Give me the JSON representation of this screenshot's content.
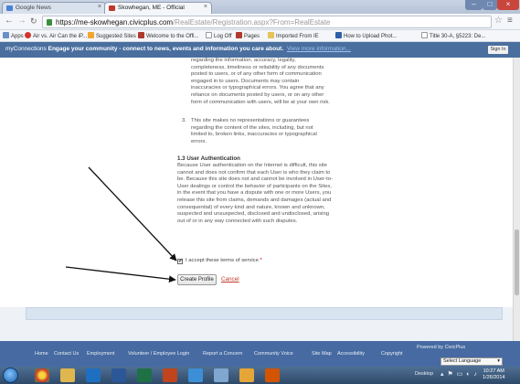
{
  "browser": {
    "tabs": [
      {
        "label": "Google News"
      },
      {
        "label": "Skowhegan, ME - Official"
      }
    ],
    "url": {
      "host": "https://me-skowhegan.civicplus.com",
      "path": "/RealEstate/Registration.aspx?From=RealEstate"
    },
    "bookmarks": [
      {
        "label": "Apps",
        "icon": "apps-grid-icon"
      },
      {
        "label": "Air vs. Air Can the iP...",
        "icon": "red-circle-icon"
      },
      {
        "label": "Suggested Sites",
        "icon": "suggested-sites-icon"
      },
      {
        "label": "Welcome to the Offi...",
        "icon": "civicplus-icon"
      },
      {
        "label": "Log Off",
        "icon": "page-icon"
      },
      {
        "label": "Pages",
        "icon": "civicplus-icon"
      },
      {
        "label": "Imported From IE",
        "icon": "folder-icon"
      },
      {
        "label": "How to Upload Phot...",
        "icon": "blue-square-icon"
      },
      {
        "label": "Title 30-A, §5223: De...",
        "icon": "page-icon"
      }
    ],
    "colors": {
      "banner": "#4a6f9f",
      "footer": "#466aa1",
      "cancel": "#c0392b"
    }
  },
  "banner": {
    "brand": "myConnections",
    "message": "Engage your community - connect to news, events and information you care about.",
    "link": "View more information...",
    "signin": "Sign In"
  },
  "content": {
    "para_continued": "regarding the information, accuracy, legality, completeness, timeliness or reliability of any documents posted to users, or of any other form of communication engaged in to users. Documents may contain inaccuracies or typographical errors. You agree that any reliance on documents posted by users, or on any other form of communication with users, will be at your own risk.",
    "item3_number": "3.",
    "item3_text": "This site makes no representations or guarantees regarding the content of the sites, including, but not limited to, broken links, inaccuracies or typographical errors.",
    "section_heading": "1.3 User Authentication",
    "section_body": "Because User authentication on the Internet is difficult, this site cannot and does not confirm that each User is who they claim to be. Because this site does not and cannot be involved in User-to-User dealings or control the behavior of participants on the Sites, in the event that you have a dispute with one or more Users, you release this site from claims, demands and damages (actual and consequential) of every kind and nature, known and unknown, suspected and unsuspected, disclosed and undisclosed, arising out of or in any way connected with such disputes.",
    "accept_label": "I accept these terms of service",
    "accept_required": "*",
    "accept_checked": true,
    "create_profile": "Create Profile",
    "cancel": "Cancel"
  },
  "footer": {
    "links": [
      "Home",
      "Contact Us",
      "Employment",
      "Volunteer / Employee Login",
      "Report a Concern",
      "Community Voice",
      "Site Map",
      "Accessibility",
      "Copyright",
      "Powered by CivicPlus"
    ],
    "language": "Select Language"
  },
  "taskbar": {
    "apps": [
      "chrome-icon",
      "explorer-folder-icon",
      "outlook-icon",
      "word-icon",
      "excel-icon",
      "powerpoint-icon",
      "ie-icon",
      "paint-icon",
      "photo-icon",
      "app-icon"
    ],
    "desktop_label": "Desktop",
    "time": "10:27 AM",
    "date": "1/26/2014"
  }
}
